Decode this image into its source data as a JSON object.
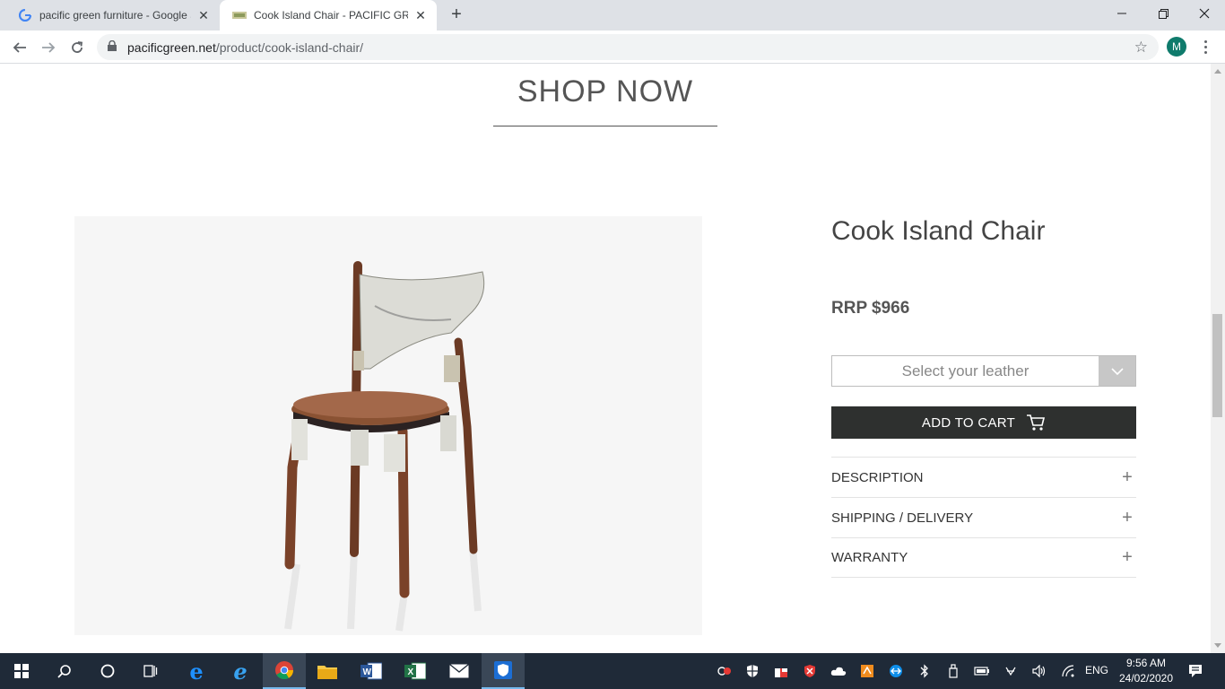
{
  "browser": {
    "tabs": [
      {
        "title": "pacific green furniture - Google S",
        "favicon": "google-icon"
      },
      {
        "title": "Cook Island Chair - PACIFIC GREE",
        "favicon": "pacific-green-icon"
      }
    ],
    "url_host": "pacificgreen.net",
    "url_path": "/product/cook-island-chair/",
    "profile_initial": "M"
  },
  "page": {
    "section_heading": "SHOP NOW",
    "product": {
      "name": "Cook Island Chair",
      "price": "RRP $966",
      "leather_select_placeholder": "Select your leather",
      "add_to_cart_label": "ADD TO CART",
      "image_alt": "chair-photo"
    },
    "accordion": [
      {
        "label": "DESCRIPTION"
      },
      {
        "label": "SHIPPING / DELIVERY"
      },
      {
        "label": "WARRANTY"
      }
    ]
  },
  "taskbar": {
    "apps": [
      "windows-start-icon",
      "search-icon",
      "cortana-icon",
      "task-view-icon",
      "edge-icon",
      "internet-explorer-icon",
      "chrome-icon",
      "file-explorer-icon",
      "word-icon",
      "excel-icon",
      "mail-icon",
      "security-app-icon"
    ],
    "language": "ENG",
    "time": "9:56 AM",
    "date": "24/02/2020"
  },
  "colors": {
    "accent_dark": "#2e302f",
    "taskbar": "#1f2a38",
    "avatar": "#0f7b6c"
  }
}
